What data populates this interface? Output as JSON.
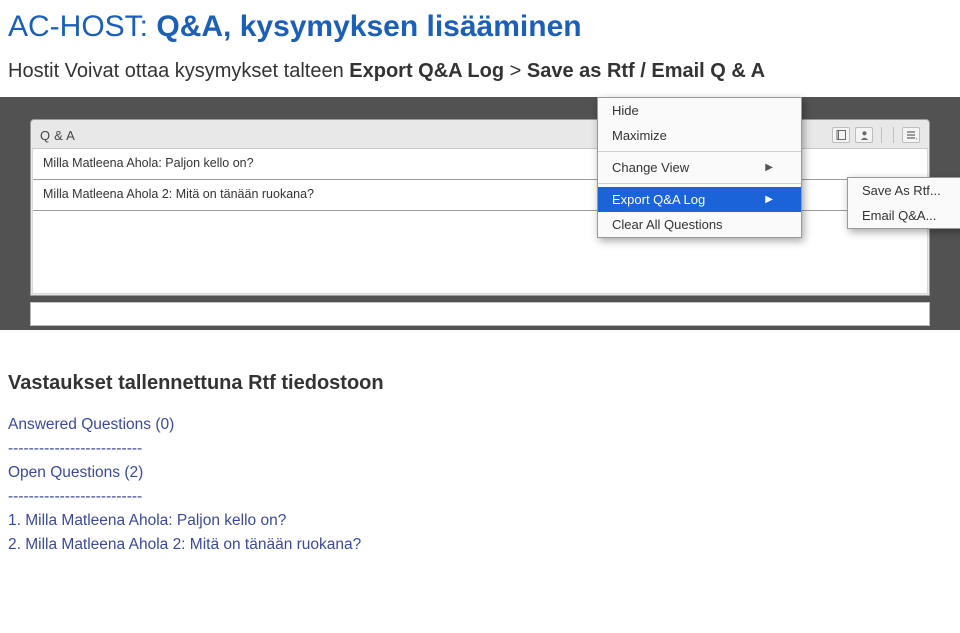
{
  "heading": {
    "prefix": "AC-HOST: ",
    "bold": "Q&A, kysymyksen lisääminen"
  },
  "subheading": {
    "text": "Hostit Voivat ottaa kysymykset talteen ",
    "boldA": "Export Q&A Log",
    "mid": " > ",
    "boldB": "Save as Rtf / Email Q & A"
  },
  "panel": {
    "title": "Q & A",
    "rows": [
      "Milla Matleena Ahola: Paljon kello on?",
      "Milla Matleena Ahola 2: Mitä on tänään ruokana?"
    ]
  },
  "menu": {
    "items": [
      {
        "label": "Hide",
        "arrow": false
      },
      {
        "label": "Maximize",
        "arrow": false
      },
      {
        "sep": true
      },
      {
        "label": "Change View",
        "arrow": true
      },
      {
        "sep": true
      },
      {
        "label": "Export Q&A Log",
        "arrow": true,
        "selected": true
      },
      {
        "label": "Clear All Questions",
        "arrow": false
      }
    ],
    "submenu": [
      {
        "label": "Save As Rtf..."
      },
      {
        "label": "Email Q&A..."
      }
    ]
  },
  "caption": "Vastaukset tallennettuna Rtf tiedostoon",
  "rtf": {
    "l1": "Answered Questions (0)",
    "l2": "--------------------------",
    "l3": "Open Questions (2)",
    "l4": "--------------------------",
    "l5": "1. Milla Matleena Ahola: Paljon kello on?",
    "l6": "2. Milla Matleena Ahola 2: Mitä on tänään ruokana?"
  }
}
